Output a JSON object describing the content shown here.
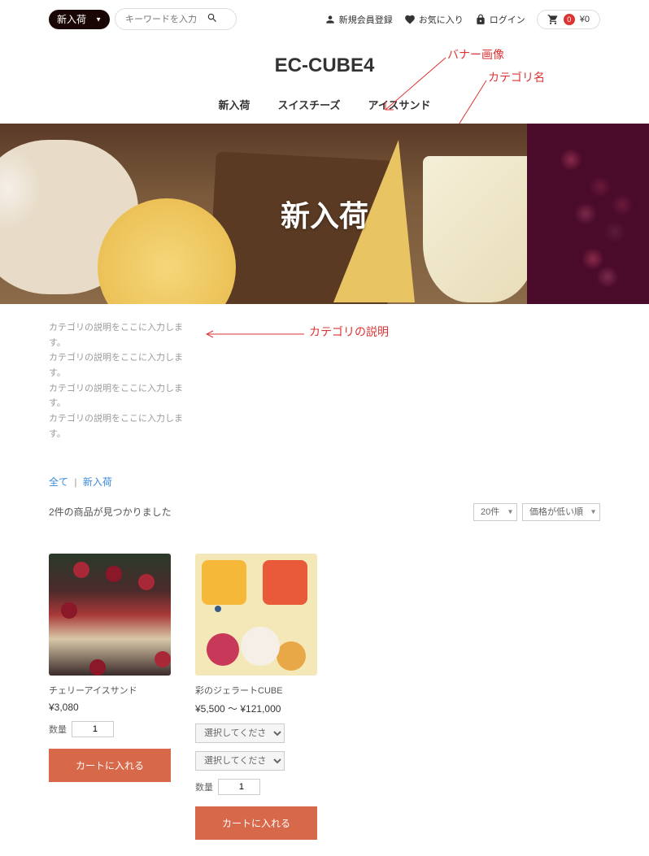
{
  "header": {
    "category_select": "新入荷",
    "search_placeholder": "キーワードを入力",
    "register": "新規会員登録",
    "favorite": "お気に入り",
    "login": "ログイン",
    "cart_count": "0",
    "cart_total": "¥0"
  },
  "logo": "EC-CUBE4",
  "nav": [
    "新入荷",
    "スイスチーズ",
    "アイスサンド"
  ],
  "annotations": {
    "banner": "バナー画像",
    "category_name": "カテゴリ名",
    "category_desc": "カテゴリの説明"
  },
  "hero": {
    "title": "新入荷"
  },
  "description_lines": [
    "カテゴリの説明をここに入力します。",
    "カテゴリの説明をここに入力します。",
    "カテゴリの説明をここに入力します。",
    "カテゴリの説明をここに入力します。"
  ],
  "breadcrumb": {
    "all": "全て",
    "current": "新入荷"
  },
  "result_count": "2件の商品が見つかりました",
  "sort": {
    "per_page": "20件",
    "order": "価格が低い順"
  },
  "labels": {
    "qty": "数量",
    "select_placeholder": "選択してください",
    "add_to_cart": "カートに入れる"
  },
  "products": [
    {
      "name": "チェリーアイスサンド",
      "price": "¥3,080",
      "qty": "1",
      "has_options": false
    },
    {
      "name": "彩のジェラートCUBE",
      "price": "¥5,500 ～ ¥121,000",
      "qty": "1",
      "has_options": true
    }
  ]
}
